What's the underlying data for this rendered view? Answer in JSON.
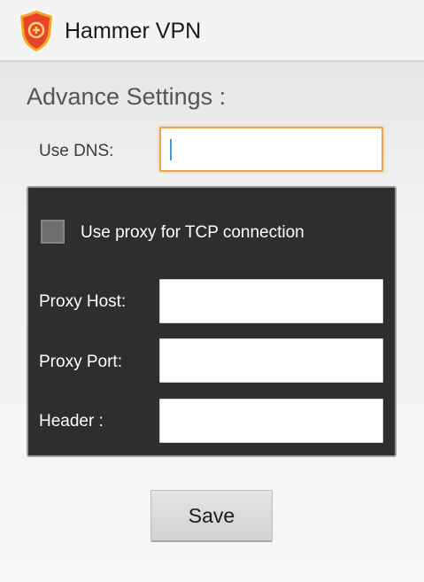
{
  "app": {
    "title": "Hammer VPN",
    "icon": "hammer-vpn-shield-icon",
    "brand_color": "#e8442a"
  },
  "settings": {
    "heading": "Advance Settings :",
    "dns": {
      "label": "Use DNS:",
      "value": "",
      "placeholder": "",
      "focused": true
    },
    "proxy": {
      "checkbox_label": "Use proxy for TCP connection",
      "checked": false,
      "fields": [
        {
          "label": "Proxy Host:",
          "value": ""
        },
        {
          "label": "Proxy Port:",
          "value": ""
        },
        {
          "label": "Header :",
          "value": ""
        }
      ]
    },
    "save_label": "Save"
  },
  "colors": {
    "focus_accent": "#f0a34a",
    "panel_background": "#2e2e2e"
  }
}
